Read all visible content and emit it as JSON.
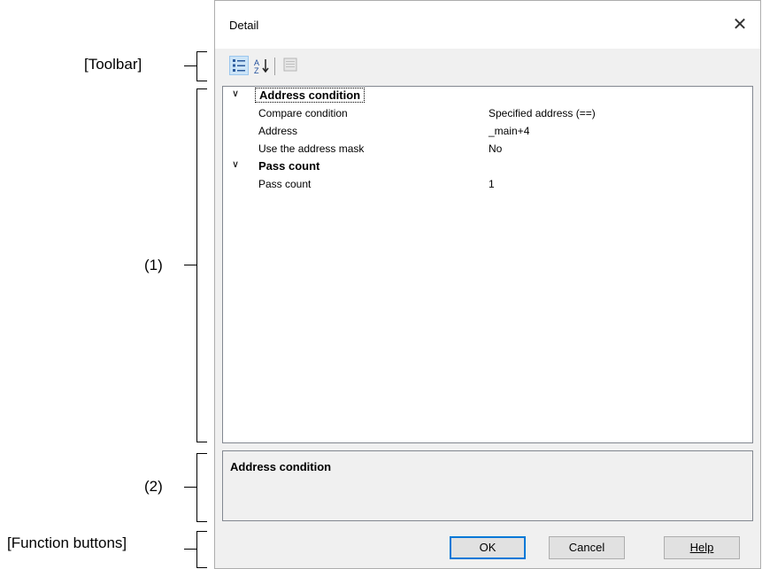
{
  "annotations": {
    "toolbar": "[Toolbar]",
    "area1": "(1)",
    "area2": "(2)",
    "function_buttons": "[Function buttons]"
  },
  "dialog": {
    "title": "Detail",
    "close_glyph": "✕"
  },
  "toolbar": {
    "buttons": [
      {
        "icon": "categorized-view-icon",
        "active": true
      },
      {
        "icon": "alphabetical-sort-icon",
        "active": false
      },
      {
        "icon": "property-pages-icon",
        "active": false
      }
    ]
  },
  "property_grid": {
    "categories": [
      {
        "label": "Address condition",
        "chevron": "∨",
        "selected": true,
        "properties": [
          {
            "name": "Compare condition",
            "value": "Specified address (==)"
          },
          {
            "name": "Address",
            "value": "_main+4"
          },
          {
            "name": "Use the address mask",
            "value": "No"
          }
        ]
      },
      {
        "label": "Pass count",
        "chevron": "∨",
        "selected": false,
        "properties": [
          {
            "name": "Pass count",
            "value": "1"
          }
        ]
      }
    ]
  },
  "description": {
    "title": "Address condition"
  },
  "buttons": {
    "ok": "OK",
    "cancel": "Cancel",
    "help": "Help"
  },
  "colors": {
    "dialog_bg": "#f0f0f0",
    "grid_bg": "#ffffff",
    "default_button_border": "#0078d7"
  }
}
